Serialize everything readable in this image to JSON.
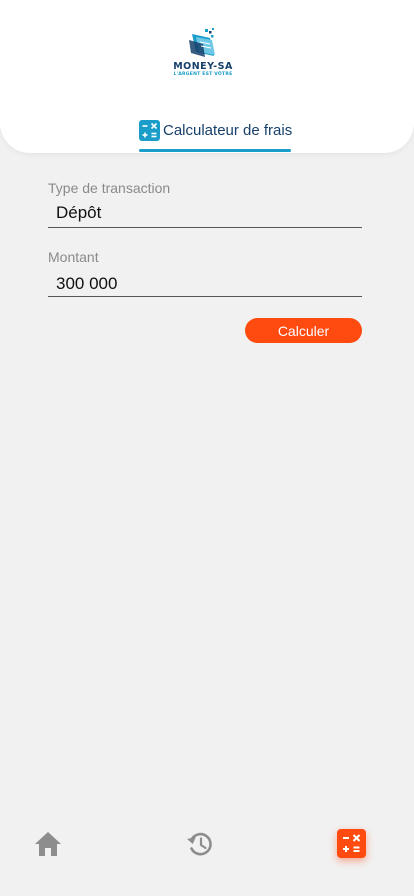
{
  "brand": {
    "name": "MONEY-SA",
    "tagline": "L'ARGENT EST VÔTRE"
  },
  "header": {
    "tab_label": "Calculateur de frais",
    "tab_icon": "calculator-icon"
  },
  "form": {
    "transaction_type": {
      "label": "Type de transaction",
      "value": "Dépôt"
    },
    "amount": {
      "label": "Montant",
      "value": "300 000"
    },
    "submit_label": "Calculer"
  },
  "bottom_nav": {
    "items": [
      {
        "id": "home",
        "icon": "home-icon",
        "active": false
      },
      {
        "id": "history",
        "icon": "history-icon",
        "active": false
      },
      {
        "id": "calculator",
        "icon": "calculator-icon",
        "active": true
      }
    ]
  },
  "colors": {
    "accent": "#ff4a10",
    "brand_blue": "#16406b",
    "tab_blue": "#1a9dc9",
    "background": "#f1f1f1",
    "icon_gray": "#8d8d8d"
  }
}
